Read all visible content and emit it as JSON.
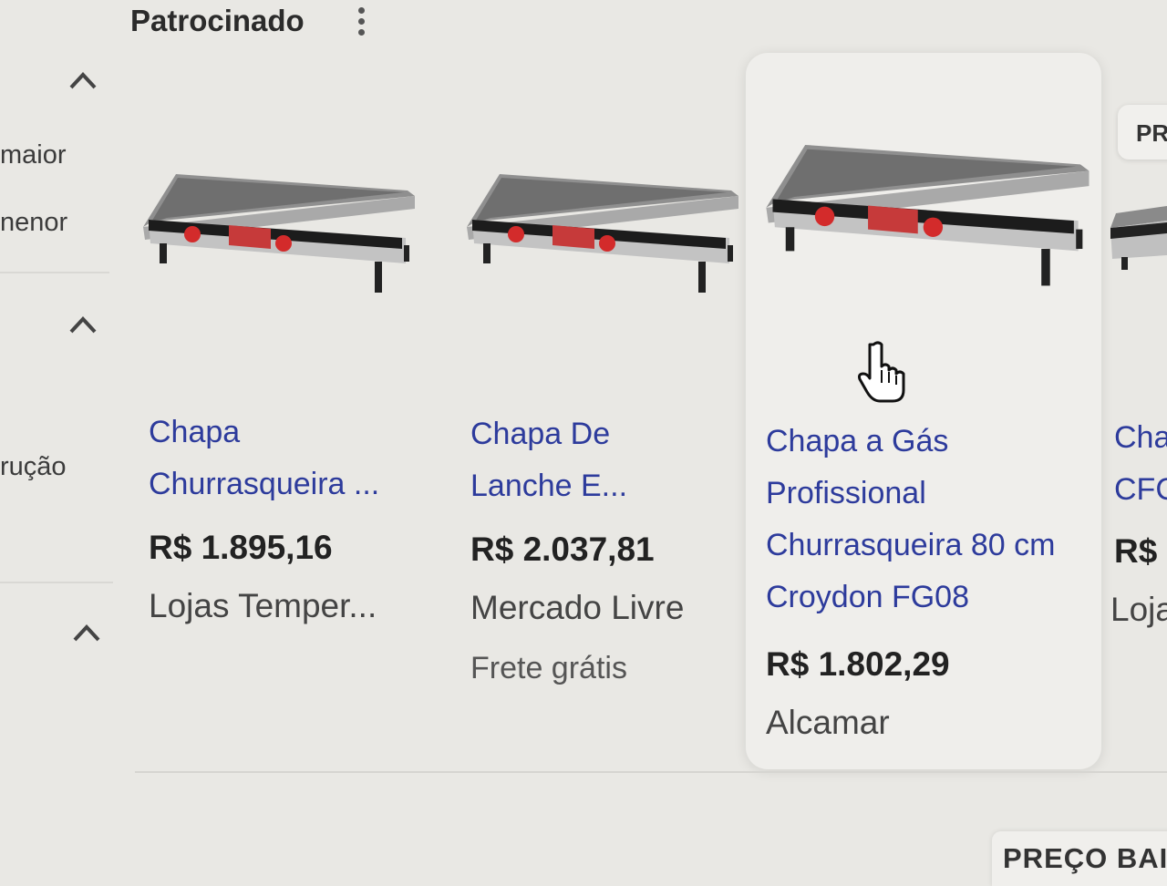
{
  "header": {
    "sponsored_label": "Patrocinado",
    "more_icon": "kebab-menu-icon"
  },
  "sidebar": {
    "items": [
      {
        "label": "maior"
      },
      {
        "label": "nenor"
      },
      {
        "label": "rução"
      }
    ],
    "collapse_icon": "chevron-up-icon"
  },
  "products": [
    {
      "title_lines": [
        "Chapa",
        "Churrasqueira ..."
      ],
      "price": "R$ 1.895,16",
      "merchant": "Lojas Temper...",
      "image": "griddle-icon"
    },
    {
      "title_lines": [
        "Chapa De",
        "Lanche E..."
      ],
      "price": "R$ 2.037,81",
      "merchant": "Mercado Livre",
      "shipping": "Frete grátis",
      "image": "griddle-icon"
    },
    {
      "title_lines": [
        "Chapa a Gás",
        "Profissional",
        "Churrasqueira 80 cm",
        "Croydon FG08"
      ],
      "price": "R$ 1.802,29",
      "merchant": "Alcamar",
      "image": "griddle-icon"
    },
    {
      "title_lines": [
        "Cha",
        "CFC"
      ],
      "price": "R$",
      "merchant": "Loja",
      "image": "griddle-icon"
    }
  ],
  "badge": {
    "label": "PR"
  },
  "price_filter": {
    "label": "PREÇO BAIX"
  },
  "colors": {
    "link": "#2d3b9c",
    "background": "#e9e8e4",
    "accent": "#d32b2b"
  }
}
